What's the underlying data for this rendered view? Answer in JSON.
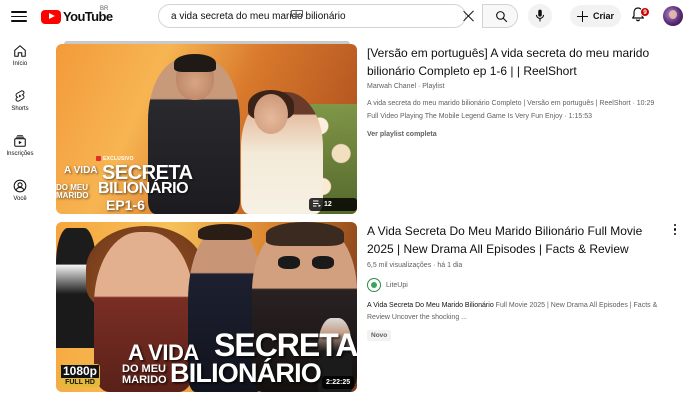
{
  "header": {
    "logo_text": "YouTube",
    "logo_country": "BR",
    "search_value": "a vida secreta do meu marido bilionário",
    "create_label": "Criar",
    "notification_count": "9"
  },
  "sidebar": {
    "items": [
      {
        "label": "Início",
        "icon": "home-icon"
      },
      {
        "label": "Shorts",
        "icon": "shorts-icon"
      },
      {
        "label": "Inscrições",
        "icon": "subscriptions-icon"
      },
      {
        "label": "Você",
        "icon": "you-icon"
      }
    ]
  },
  "results": [
    {
      "type": "playlist",
      "title": "[Versão em português] A vida secreta do meu marido bilionário Completo ep 1-6 | | ReelShort",
      "channel_line": "Marwah Chanel · Playlist",
      "desc_line1": "A vida secreta do meu marido bilionário Completo | Versão em português | ReelShort · 10:29",
      "desc_line2": "Full Video Playing The Mobile Legend Game Is Very Fun Enjoy · 1:15:53",
      "link": "Ver playlist completa",
      "thumb": {
        "exclusive": "EXCLUSIVO",
        "line_a": "A VIDA",
        "line_b": "SECRETA",
        "line_c": "DO MEU MARIDO",
        "line_d": "BILIONÁRIO",
        "line_e": "EP1-6",
        "badge": "12 vídeos"
      }
    },
    {
      "type": "video",
      "title": "A Vida Secreta Do Meu Marido Bilionário Full Movie 2025 | New Drama All Episodes | Facts & Review",
      "meta": "6,5 mil visualizações · há 1 dia",
      "channel": "LiteUpi",
      "desc_bold": "A Vida Secreta Do Meu Marido Bilionário",
      "desc_rest": " Full Movie 2025 | New Drama All Episodes | Facts & Review Uncover the shocking ...",
      "new_badge": "Novo",
      "thumb": {
        "line_a": "A VIDA",
        "line_b": "SECRETA",
        "line_c": "DO MEU MARIDO",
        "line_d": "BILIONÁRIO",
        "hd_top": "1080p",
        "hd_bottom": "FULL HD",
        "duration": "2:22:25"
      }
    }
  ],
  "colors": {
    "brand_red": "#ff0000",
    "text_primary": "#0f0f0f",
    "text_secondary": "#606060",
    "badge_red": "#cc0000"
  }
}
